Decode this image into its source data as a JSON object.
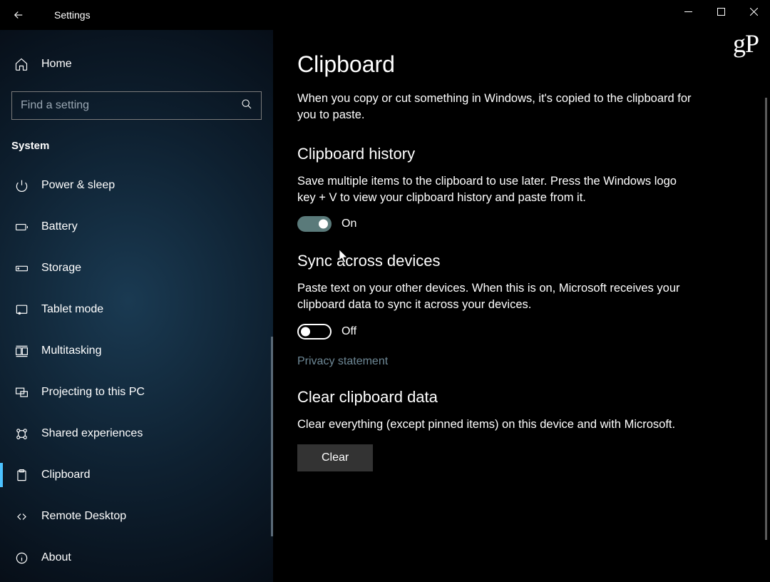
{
  "titlebar": {
    "title": "Settings"
  },
  "watermark": "gP",
  "sidebar": {
    "home_label": "Home",
    "search_placeholder": "Find a setting",
    "section_label": "System",
    "items": [
      {
        "id": "power-sleep",
        "label": "Power & sleep",
        "active": false
      },
      {
        "id": "battery",
        "label": "Battery",
        "active": false
      },
      {
        "id": "storage",
        "label": "Storage",
        "active": false
      },
      {
        "id": "tablet-mode",
        "label": "Tablet mode",
        "active": false
      },
      {
        "id": "multitasking",
        "label": "Multitasking",
        "active": false
      },
      {
        "id": "projecting",
        "label": "Projecting to this PC",
        "active": false
      },
      {
        "id": "shared-experiences",
        "label": "Shared experiences",
        "active": false
      },
      {
        "id": "clipboard",
        "label": "Clipboard",
        "active": true
      },
      {
        "id": "remote-desktop",
        "label": "Remote Desktop",
        "active": false
      },
      {
        "id": "about",
        "label": "About",
        "active": false
      }
    ]
  },
  "main": {
    "title": "Clipboard",
    "intro": "When you copy or cut something in Windows, it's copied to the clipboard for you to paste.",
    "history": {
      "heading": "Clipboard history",
      "desc": "Save multiple items to the clipboard to use later. Press the Windows logo key + V to view your clipboard history and paste from it.",
      "toggle_state": "On",
      "toggle_on": true
    },
    "sync": {
      "heading": "Sync across devices",
      "desc": "Paste text on your other devices. When this is on, Microsoft receives your clipboard data to sync it across your devices.",
      "toggle_state": "Off",
      "toggle_on": false,
      "link": "Privacy statement"
    },
    "clear": {
      "heading": "Clear clipboard data",
      "desc": "Clear everything (except pinned items) on this device and with Microsoft.",
      "button": "Clear"
    }
  }
}
